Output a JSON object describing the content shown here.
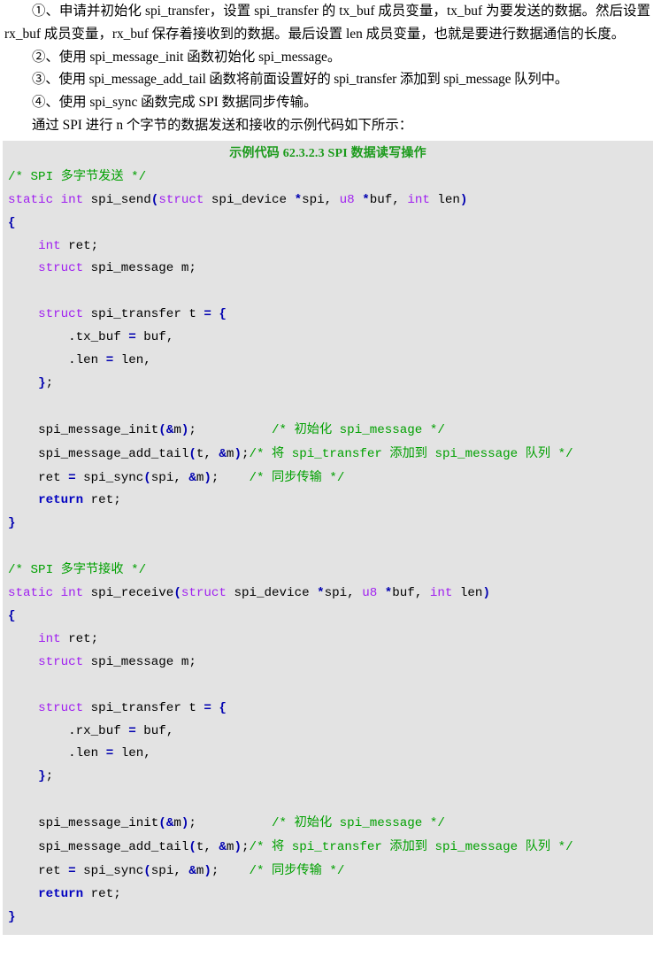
{
  "document": {
    "type": "technical-manual-page",
    "language": "zh-CN",
    "paragraphs": [
      "①、申请并初始化 spi_transfer，设置 spi_transfer 的 tx_buf 成员变量，tx_buf 为要发送的数据。然后设置 rx_buf 成员变量，rx_buf 保存着接收到的数据。最后设置 len 成员变量，也就是要进行数据通信的长度。",
      "②、使用 spi_message_init 函数初始化 spi_message。",
      "③、使用 spi_message_add_tail 函数将前面设置好的 spi_transfer 添加到 spi_message 队列中。",
      "④、使用 spi_sync 函数完成 SPI 数据同步传输。",
      "通过 SPI 进行 n 个字节的数据发送和接收的示例代码如下所示："
    ]
  },
  "code_block": {
    "title": "示例代码 62.3.2.3 SPI 数据读写操作",
    "language": "c",
    "background_color": "#e3e3e3",
    "title_color": "#1a9a1a",
    "colors": {
      "comment": "#00a000",
      "keyword": "#a020f0",
      "operator": "#0000b0",
      "bold_keyword": "#0000c0",
      "plain": "#000000"
    },
    "lines": [
      "/* SPI 多字节发送 */",
      "static int spi_send(struct spi_device *spi, u8 *buf, int len)",
      "{",
      "    int ret;",
      "    struct spi_message m;",
      "",
      "    struct spi_transfer t = {",
      "        .tx_buf = buf,",
      "        .len = len,",
      "    };",
      "",
      "    spi_message_init(&m);          /* 初始化 spi_message */",
      "    spi_message_add_tail(t, &m);/* 将 spi_transfer 添加到 spi_message 队列 */",
      "    ret = spi_sync(spi, &m);    /* 同步传输 */",
      "    return ret;",
      "}",
      "",
      "/* SPI 多字节接收 */",
      "static int spi_receive(struct spi_device *spi, u8 *buf, int len)",
      "{",
      "    int ret;",
      "    struct spi_message m;",
      "",
      "    struct spi_transfer t = {",
      "        .rx_buf = buf,",
      "        .len = len,",
      "    };",
      "",
      "    spi_message_init(&m);          /* 初始化 spi_message */",
      "    spi_message_add_tail(t, &m);/* 将 spi_transfer 添加到 spi_message 队列 */",
      "    ret = spi_sync(spi, &m);    /* 同步传输 */",
      "    return ret;",
      "}"
    ]
  }
}
